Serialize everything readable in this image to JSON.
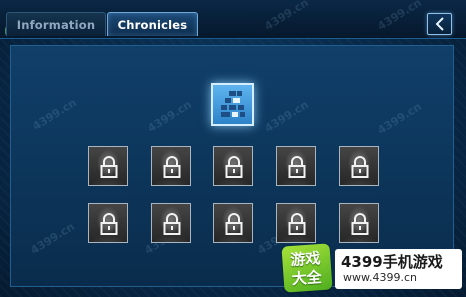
{
  "tabs": [
    {
      "label": "Information",
      "active": false
    },
    {
      "label": "Chronicles",
      "active": true
    }
  ],
  "back_button": {
    "icon": "chevron-left-icon"
  },
  "chronicle_node": {
    "icon": "stage-grid-icon",
    "state": "unlocked"
  },
  "cards": {
    "row1": [
      {
        "state": "locked",
        "icon": "lock-icon"
      },
      {
        "state": "locked",
        "icon": "lock-icon"
      },
      {
        "state": "locked",
        "icon": "lock-icon"
      },
      {
        "state": "locked",
        "icon": "lock-icon"
      },
      {
        "state": "locked",
        "icon": "lock-icon"
      }
    ],
    "row2": [
      {
        "state": "locked",
        "icon": "lock-icon"
      },
      {
        "state": "locked",
        "icon": "lock-icon"
      },
      {
        "state": "locked",
        "icon": "lock-icon"
      },
      {
        "state": "locked",
        "icon": "lock-icon"
      },
      {
        "state": "locked",
        "icon": "lock-icon"
      }
    ]
  },
  "watermark": {
    "text": "4399.cn"
  },
  "logo": {
    "badge_line1": "游戏",
    "badge_line2": "大全",
    "name": "4399手机游戏",
    "url": "www.4399.cn"
  },
  "colors": {
    "background": "#0a2c4c",
    "accent": "#6fa9d8",
    "node": "#3f96dc"
  }
}
